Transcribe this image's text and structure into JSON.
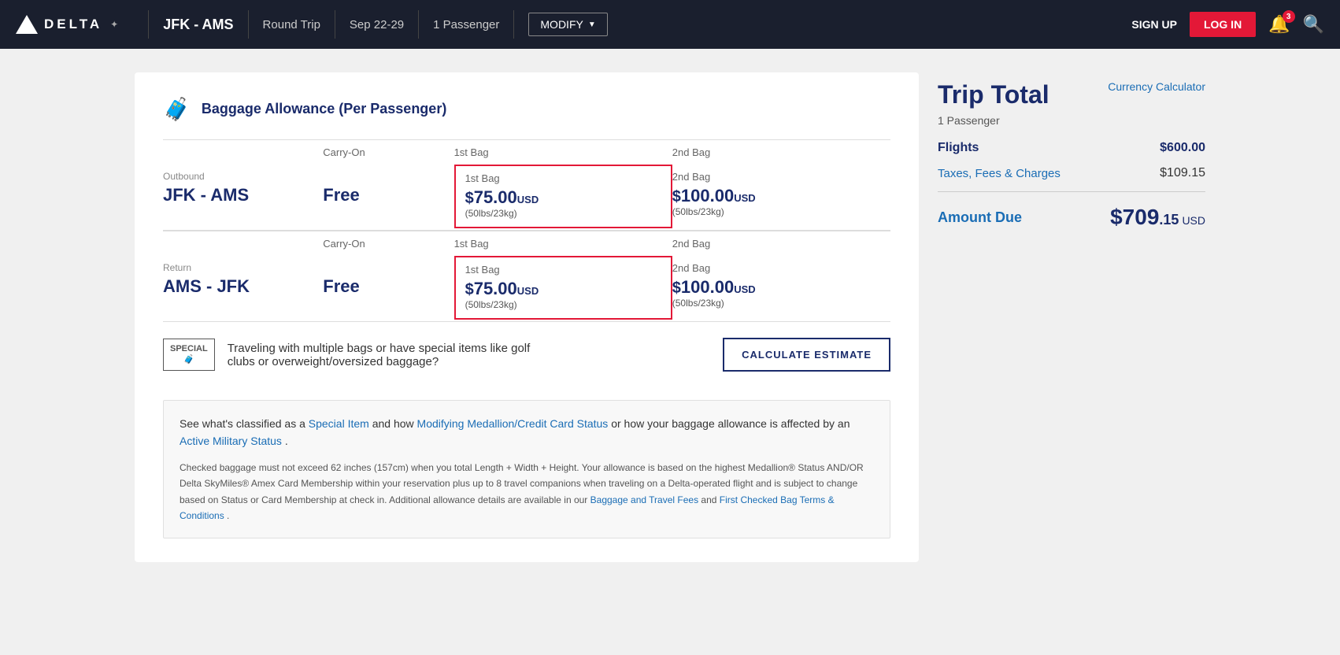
{
  "header": {
    "logo_text": "DELTA",
    "route": "JFK - AMS",
    "trip_type": "Round Trip",
    "dates": "Sep 22-29",
    "passengers": "1 Passenger",
    "modify_label": "MODIFY",
    "signup_label": "SIGN UP",
    "login_label": "LOG IN",
    "notification_count": "3"
  },
  "baggage": {
    "title": "Baggage Allowance (Per Passenger)",
    "col_headers": [
      "",
      "Carry-On",
      "1st Bag",
      "2nd Bag"
    ],
    "outbound": {
      "label": "Outbound",
      "route": "JFK - AMS",
      "carry_on": "Free",
      "first_bag_label": "1st Bag",
      "first_bag_price": "$75.00",
      "first_bag_currency": "USD",
      "first_bag_weight": "(50lbs/23kg)",
      "second_bag_label": "2nd Bag",
      "second_bag_price": "$100.00",
      "second_bag_currency": "USD",
      "second_bag_weight": "(50lbs/23kg)"
    },
    "return": {
      "label": "Return",
      "route": "AMS - JFK",
      "carry_on": "Free",
      "first_bag_label": "1st Bag",
      "first_bag_price": "$75.00",
      "first_bag_currency": "USD",
      "first_bag_weight": "(50lbs/23kg)",
      "second_bag_label": "2nd Bag",
      "second_bag_price": "$100.00",
      "second_bag_currency": "USD",
      "second_bag_weight": "(50lbs/23kg)"
    }
  },
  "estimate": {
    "special_icon_line1": "SPECIAL",
    "text": "Traveling with multiple bags or have special items like golf clubs or overweight/oversized baggage?",
    "button_label": "CALCULATE ESTIMATE"
  },
  "info_box": {
    "main_text_before": "See what's classified as a ",
    "link1": "Special Item",
    "main_text_middle1": " and how ",
    "link2": "Modifying Medallion/Credit Card Status",
    "main_text_middle2": " or how your baggage allowance is affected by an ",
    "link3": "Active Military Status",
    "main_text_after": " .",
    "detail_text": "Checked baggage must not exceed 62 inches (157cm) when you total Length + Width + Height. Your allowance is based on the highest Medallion® Status AND/OR Delta SkyMiles® Amex Card Membership within your reservation plus up to 8 travel companions when traveling on a Delta-operated flight and is subject to change based on Status or Card Membership at check in. Additional allowance details are available in our ",
    "link4": "Baggage and Travel Fees",
    "detail_text2": " and ",
    "link5": "First Checked Bag Terms & Conditions",
    "detail_text3": " ."
  },
  "trip_total": {
    "title": "Trip Total",
    "currency_calc_label": "Currency Calculator",
    "passenger_count": "1 Passenger",
    "flights_label": "Flights",
    "flights_value": "$600.00",
    "taxes_label": "Taxes, Fees & Charges",
    "taxes_value": "$109.15",
    "amount_due_label": "Amount Due",
    "amount_due_dollars": "$709",
    "amount_due_cents": ".15",
    "amount_due_currency": "USD"
  }
}
